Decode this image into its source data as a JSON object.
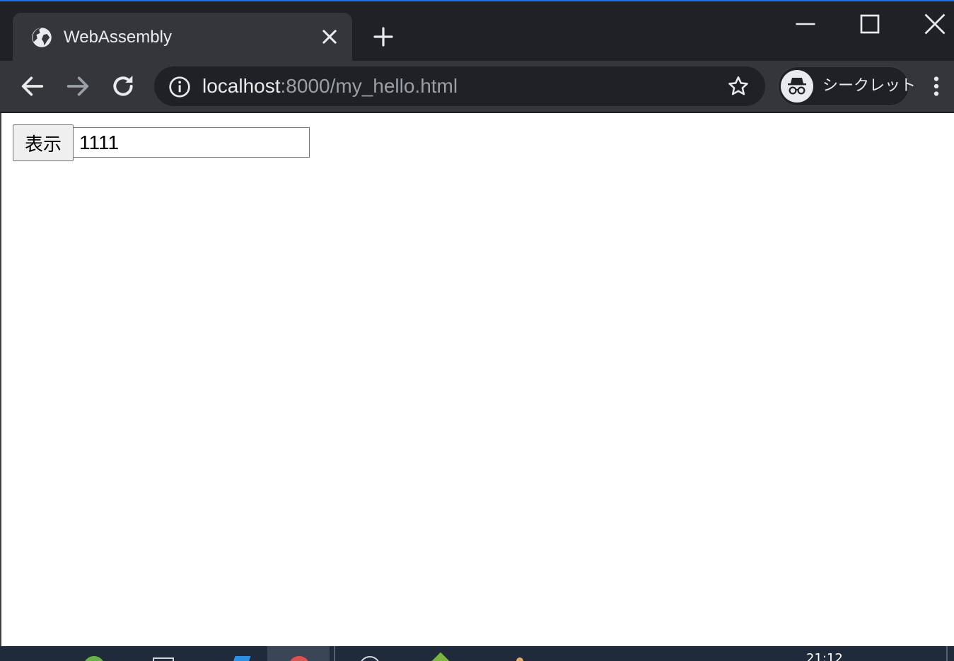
{
  "browser": {
    "tab": {
      "title": "WebAssembly",
      "favicon": "globe-icon"
    },
    "address": {
      "host": "localhost",
      "rest": ":8000/my_hello.html"
    },
    "incognito": {
      "label": "シークレット",
      "icon": "incognito-icon"
    },
    "colors": {
      "frame": "#202124",
      "toolbar": "#35363a",
      "accent": "#1a73e8",
      "text": "#e8eaed",
      "text_dim": "#9aa0a6"
    }
  },
  "page": {
    "button_label": "表示",
    "input_value": "1111"
  },
  "taskbar": {
    "clock": "21:12"
  }
}
